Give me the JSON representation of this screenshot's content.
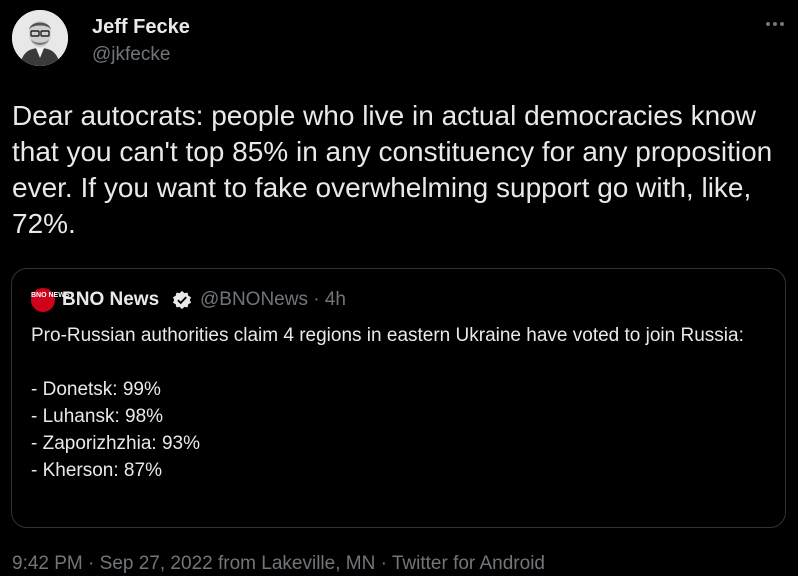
{
  "author": {
    "name": "Jeff Fecke",
    "handle": "@jkfecke",
    "more_icon": "more-horizontal-icon"
  },
  "tweet": {
    "text": "Dear autocrats: people who live in actual democracies know that you can't top 85% in any constituency for any proposition ever. If you want to fake overwhelming support go with, like, 72%."
  },
  "quoted_tweet": {
    "logo_text": "BNO NEWS",
    "name": "BNO News",
    "verified_icon": "verified-badge-icon",
    "handle_time": "@BNONews · 4h",
    "text": "Pro-Russian authorities claim 4 regions in eastern Ukraine have voted to join Russia:\n\n- Donetsk: 99%\n- Luhansk: 98%\n- Zaporizhzhia: 93%\n- Kherson: 87%"
  },
  "meta": {
    "time": "9:42 PM",
    "separator": " · ",
    "date": "Sep 27, 2022",
    "from_prefix": " from ",
    "location": "Lakeville, MN",
    "source": "Twitter for Android"
  },
  "colors": {
    "background": "#000000",
    "text": "#e7e9ea",
    "secondary": "#71767b",
    "border": "#2f3336",
    "verified": "#e7e9ea",
    "bno_red": "#d0021b"
  }
}
